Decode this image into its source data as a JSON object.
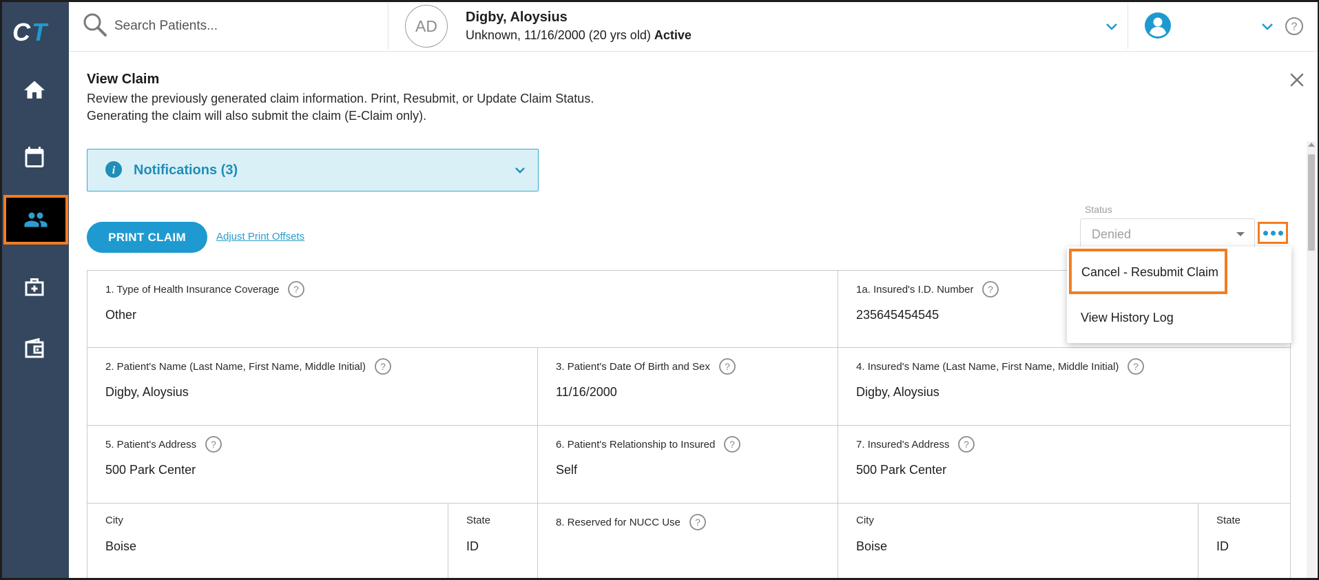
{
  "app": {
    "logo_text": "CT",
    "accent_color": "#1e9ad0",
    "sidebar_color": "#34475e",
    "highlight_color": "#f47c20"
  },
  "sidebar": {
    "items": [
      {
        "name": "home",
        "icon": "home-icon"
      },
      {
        "name": "calendar",
        "icon": "calendar-icon"
      },
      {
        "name": "patients",
        "icon": "people-icon",
        "active": true
      },
      {
        "name": "medical",
        "icon": "medical-kit-icon"
      },
      {
        "name": "wallet",
        "icon": "wallet-icon"
      }
    ]
  },
  "topbar": {
    "search_placeholder": "Search Patients...",
    "patient": {
      "initials": "AD",
      "name": "Digby, Aloysius",
      "details": "Unknown, 11/16/2000 (20 yrs old)",
      "status": "Active"
    }
  },
  "page": {
    "title": "View Claim",
    "description_line1": "Review the previously generated claim information. Print, Resubmit, or Update Claim Status.",
    "description_line2": "Generating the claim will also submit the claim (E-Claim only)."
  },
  "notifications": {
    "label": "Notifications (3)"
  },
  "actions": {
    "print_label": "PRINT CLAIM",
    "offsets_label": "Adjust Print Offsets"
  },
  "status": {
    "label": "Status",
    "value": "Denied"
  },
  "menu": {
    "items": [
      {
        "label": "Cancel - Resubmit Claim",
        "highlighted": true
      },
      {
        "label": "View History Log"
      }
    ]
  },
  "claim": {
    "f1_label": "1. Type of Health Insurance Coverage",
    "f1_value": "Other",
    "f1a_label": "1a. Insured's I.D. Number",
    "f1a_value": "235645454545",
    "f2_label": "2. Patient's Name (Last Name, First Name, Middle Initial)",
    "f2_value": "Digby, Aloysius",
    "f3_label": "3. Patient's Date Of Birth and Sex",
    "f3_value": "11/16/2000",
    "f4_label": "4. Insured's Name (Last Name, First Name, Middle Initial)",
    "f4_value": "Digby, Aloysius",
    "f5_label": "5. Patient's Address",
    "f5_value": "500 Park Center",
    "f6_label": "6. Patient's Relationship to Insured",
    "f6_value": "Self",
    "f7_label": "7. Insured's Address",
    "f7_value": "500 Park Center",
    "city_label": "City",
    "patient_city": "Boise",
    "state_label": "State",
    "patient_state": "ID",
    "f8_label": "8. Reserved for NUCC Use",
    "insured_city": "Boise",
    "insured_state": "ID"
  }
}
